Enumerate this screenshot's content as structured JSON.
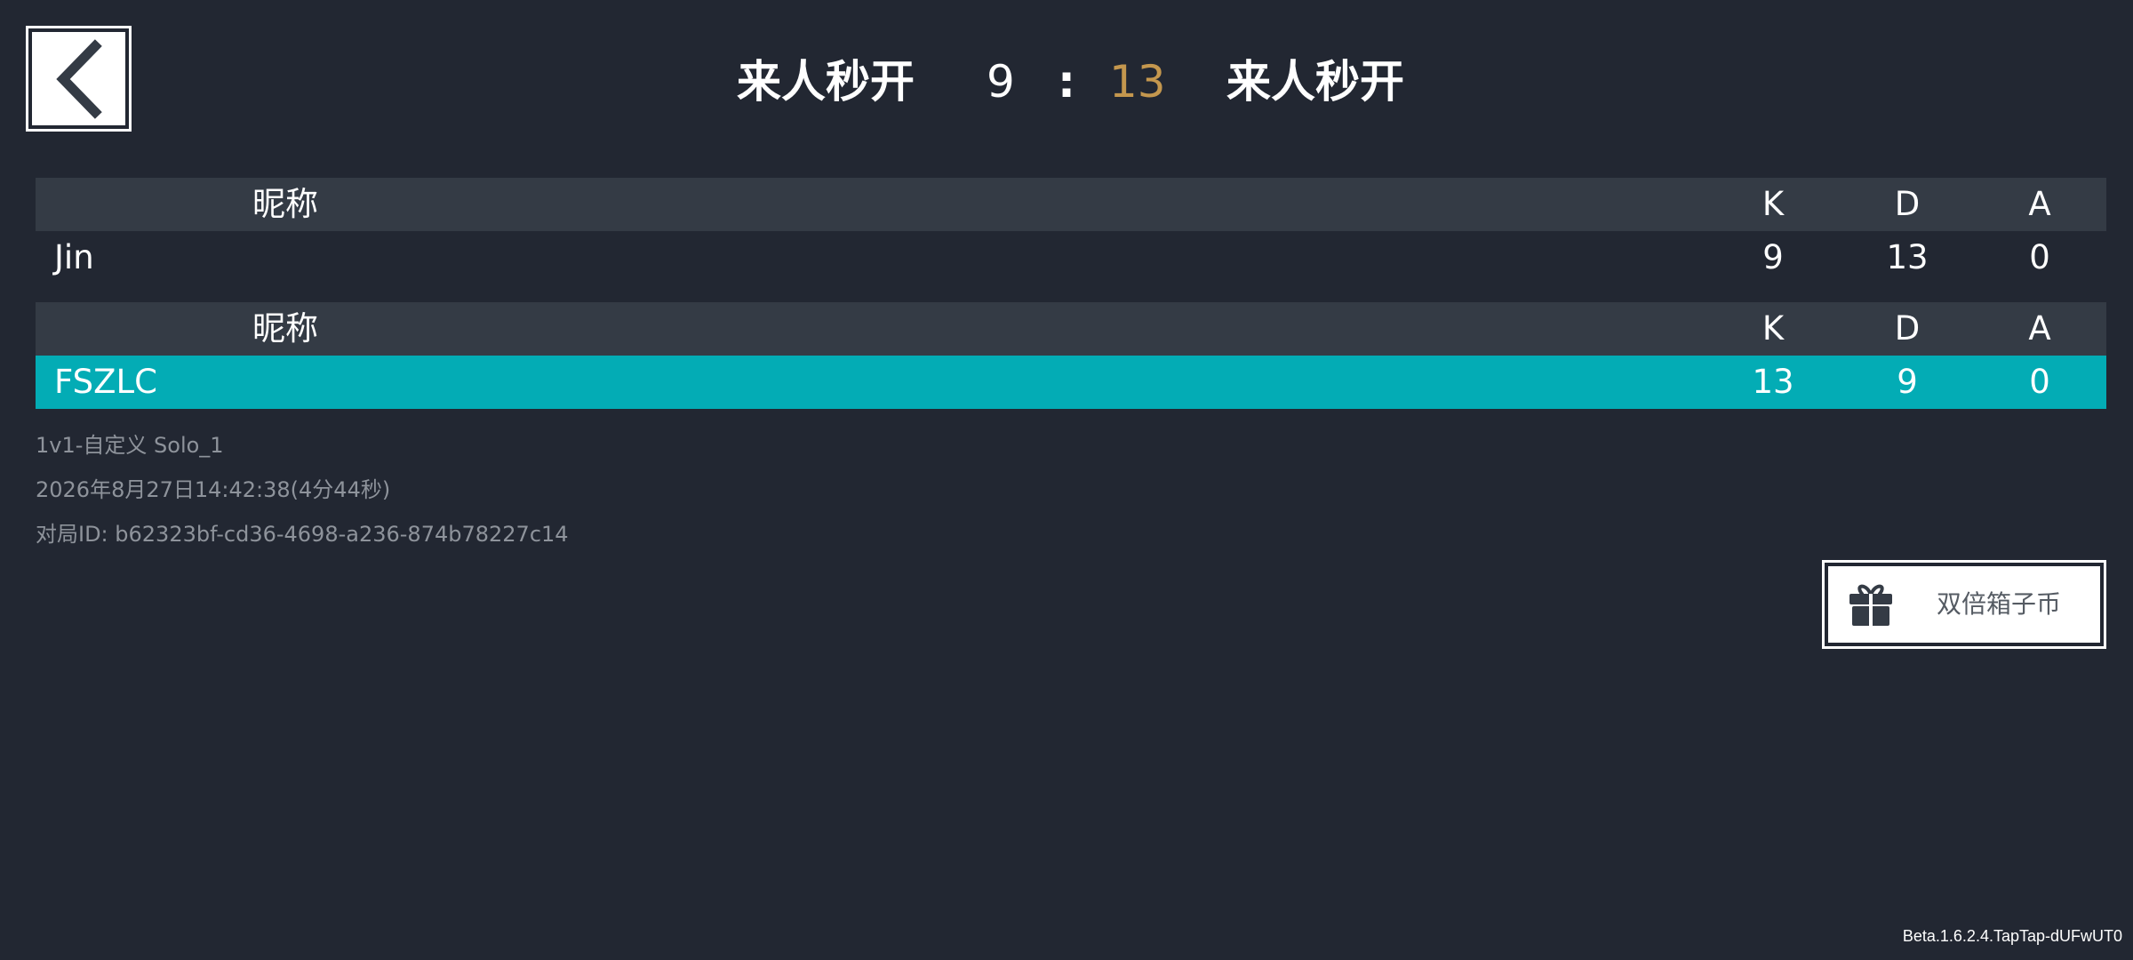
{
  "header": {
    "left_team": "来人秒开",
    "left_score": "9",
    "separator": ":",
    "right_score": "13",
    "right_team": "来人秒开"
  },
  "colors": {
    "background": "#222732",
    "header_row": "#343b45",
    "active_row": "#03acb5",
    "right_score": "#c4974e"
  },
  "icons": {
    "back": "chevron-left-icon",
    "double_coin": "gift-icon"
  },
  "tables": [
    {
      "headers": {
        "nickname": "昵称",
        "k": "K",
        "d": "D",
        "a": "A"
      },
      "rows": [
        {
          "nickname": "Jin",
          "k": "9",
          "d": "13",
          "a": "0"
        }
      ]
    },
    {
      "headers": {
        "nickname": "昵称",
        "k": "K",
        "d": "D",
        "a": "A"
      },
      "rows": [
        {
          "nickname": "FSZLC",
          "k": "13",
          "d": "9",
          "a": "0"
        }
      ]
    }
  ],
  "match_info": {
    "mode": "1v1-自定义 Solo_1",
    "time": "2026年8月27日14:42:38(4分44秒)",
    "match_id": "对局ID: b62323bf-cd36-4698-a236-874b78227c14"
  },
  "double_coin_button": {
    "label": "双倍箱子币"
  },
  "version": "Beta.1.6.2.4.TapTap-dUFwUT0"
}
